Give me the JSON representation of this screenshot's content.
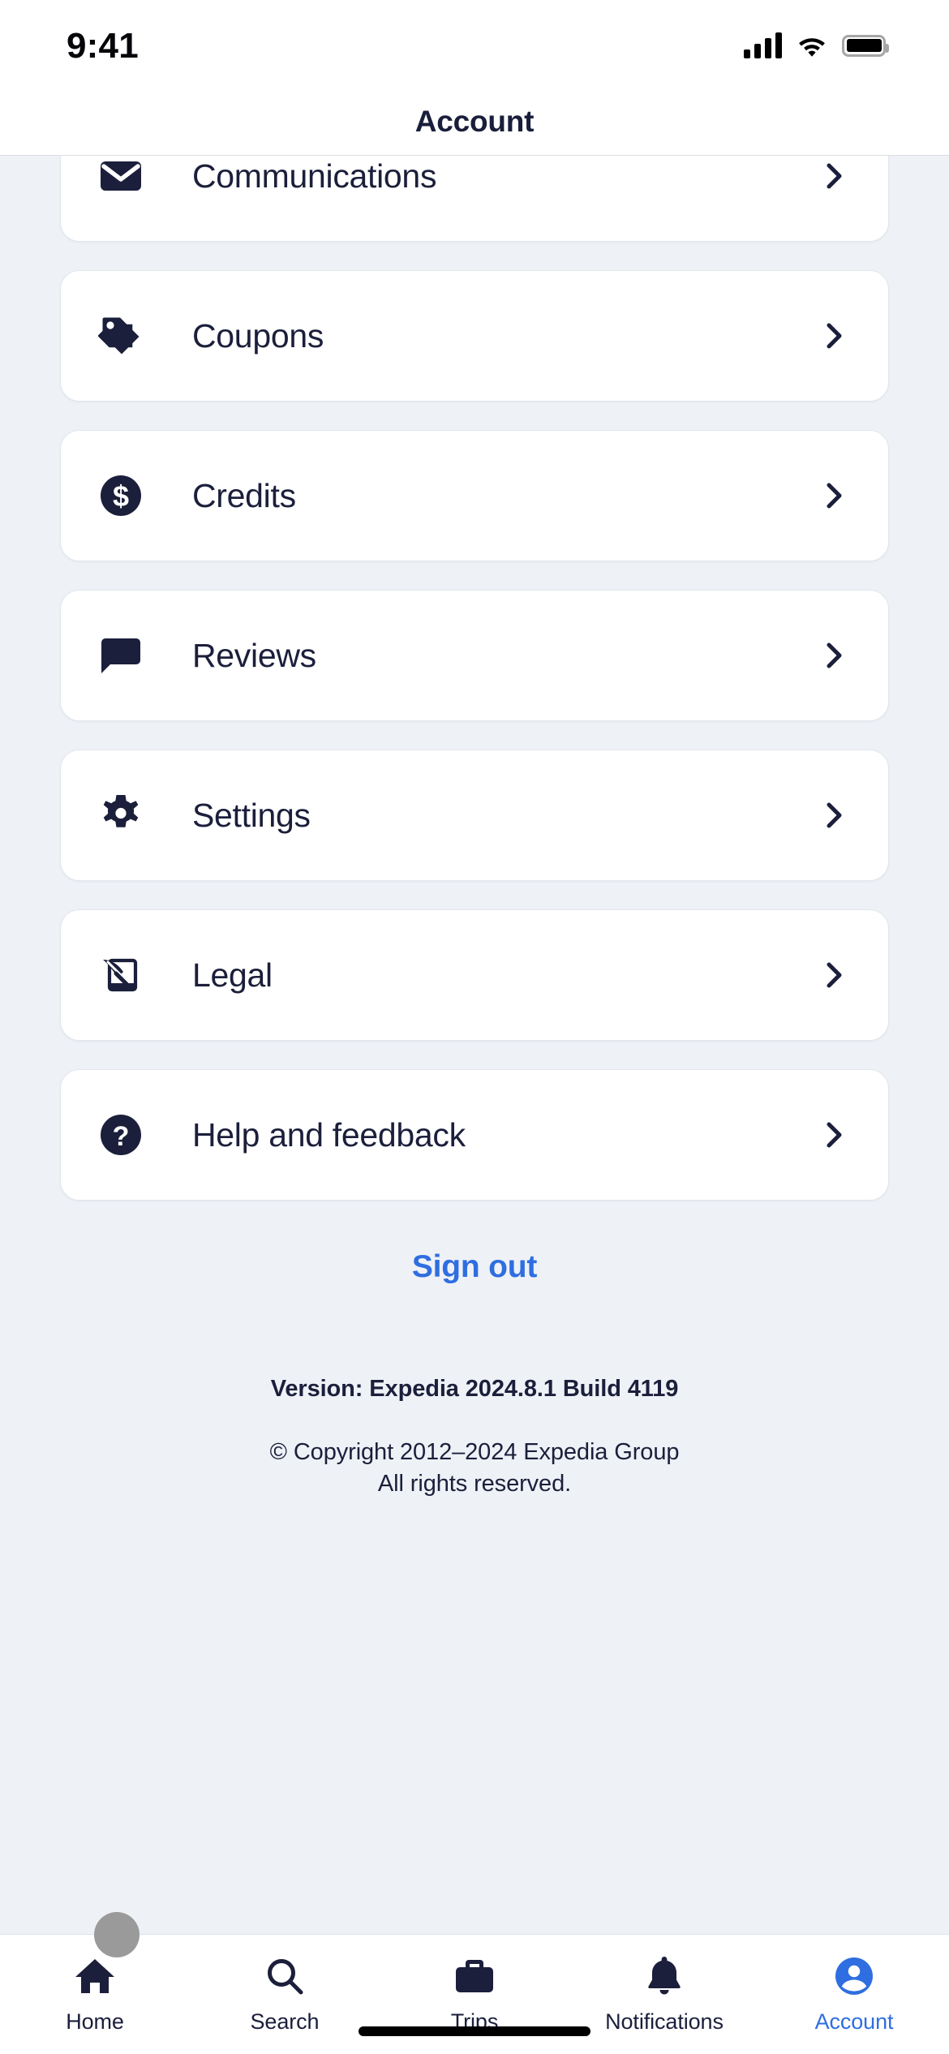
{
  "status_bar": {
    "time": "9:41",
    "signal_icon": "cellular-signal-icon",
    "wifi_icon": "wifi-icon",
    "battery_icon": "battery-full-icon"
  },
  "header": {
    "title": "Account"
  },
  "menu": {
    "items": [
      {
        "label": "Communications",
        "icon": "envelope-icon",
        "chevron": "chevron-right-icon",
        "clipped": true
      },
      {
        "label": "Coupons",
        "icon": "tag-icon",
        "chevron": "chevron-right-icon",
        "clipped": false
      },
      {
        "label": "Credits",
        "icon": "dollar-coin-icon",
        "chevron": "chevron-right-icon",
        "clipped": false
      },
      {
        "label": "Reviews",
        "icon": "chat-bubble-icon",
        "chevron": "chevron-right-icon",
        "clipped": false
      },
      {
        "label": "Settings",
        "icon": "gear-icon",
        "chevron": "chevron-right-icon",
        "clipped": false
      },
      {
        "label": "Legal",
        "icon": "quill-signature-icon",
        "chevron": "chevron-right-icon",
        "clipped": false
      },
      {
        "label": "Help and feedback",
        "icon": "question-circle-icon",
        "chevron": "chevron-right-icon",
        "clipped": false
      }
    ]
  },
  "footer": {
    "sign_out_label": "Sign out",
    "version": "Version: Expedia 2024.8.1 Build 4119",
    "copyright_line1": "© Copyright 2012–2024 Expedia Group",
    "copyright_line2": "All rights reserved."
  },
  "tab_bar": {
    "items": [
      {
        "label": "Home",
        "icon": "house-icon",
        "active": false
      },
      {
        "label": "Search",
        "icon": "magnifier-icon",
        "active": false
      },
      {
        "label": "Trips",
        "icon": "briefcase-icon",
        "active": false
      },
      {
        "label": "Notifications",
        "icon": "bell-icon",
        "active": false
      },
      {
        "label": "Account",
        "icon": "person-circle-icon",
        "active": true
      }
    ]
  },
  "colors": {
    "background": "#eef1f6",
    "card": "#ffffff",
    "ink": "#1b1f3b",
    "accent": "#2f6ee0"
  }
}
